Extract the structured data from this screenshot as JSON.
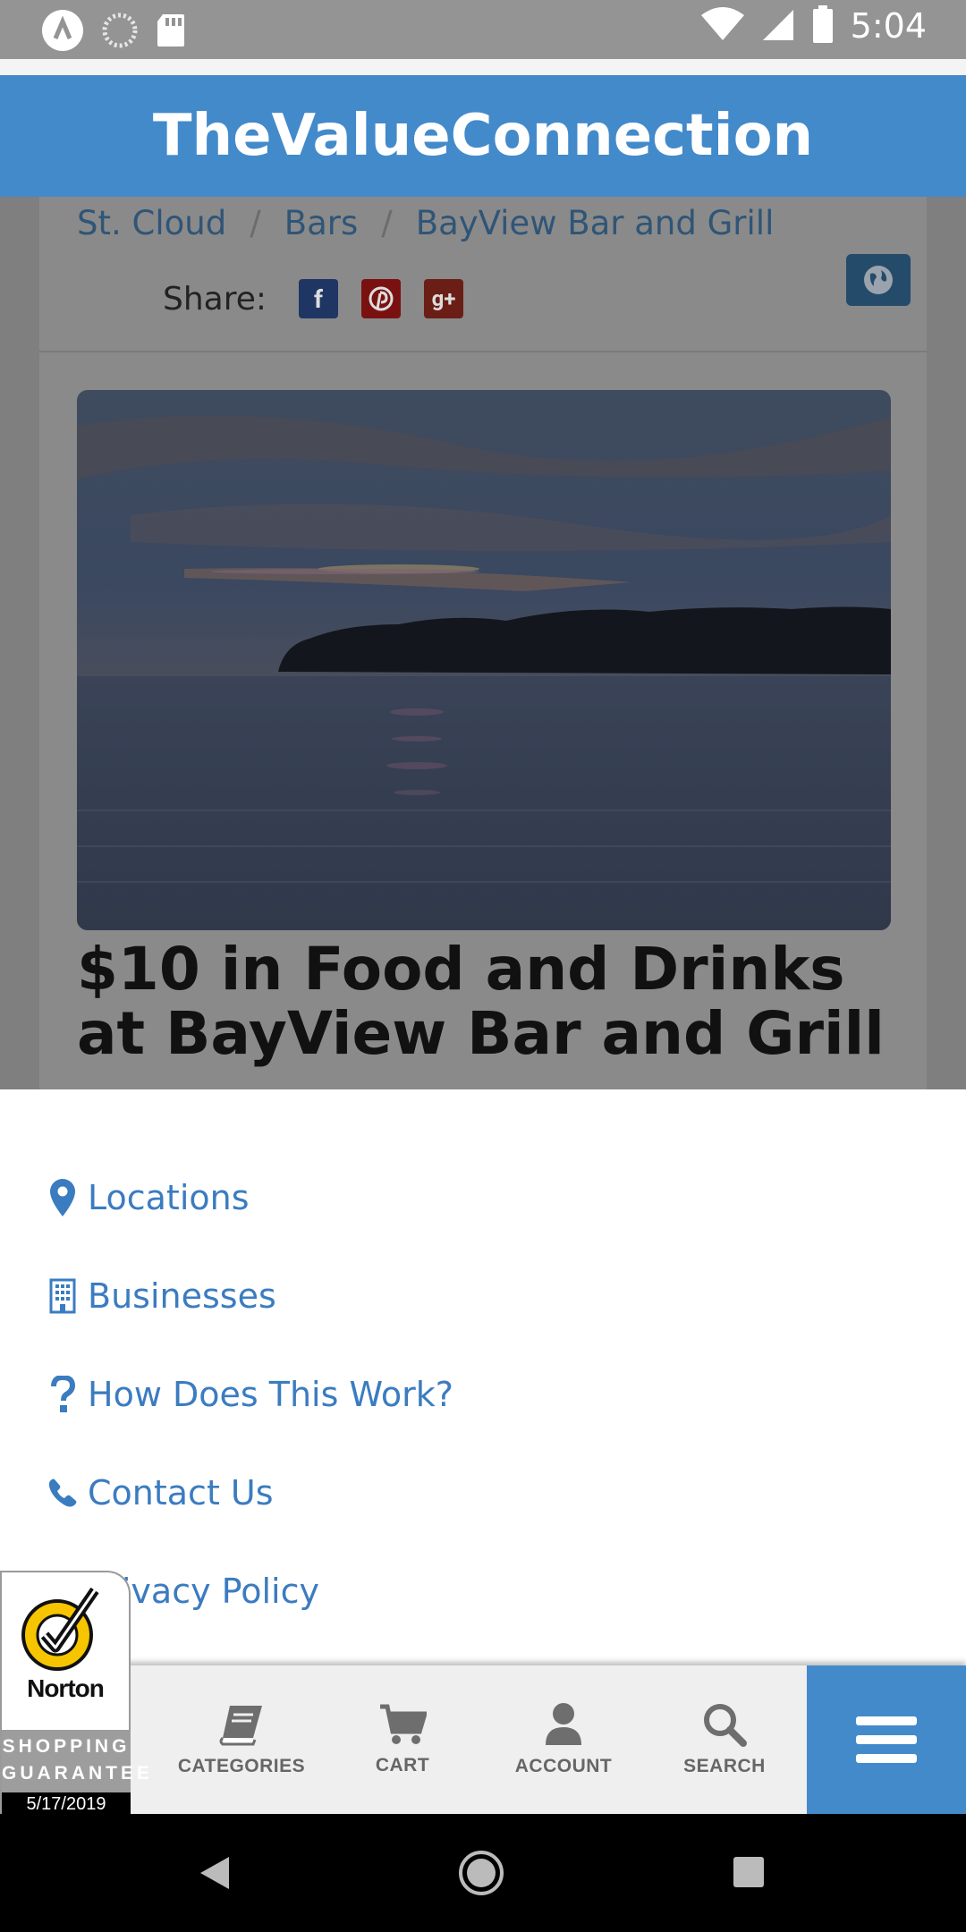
{
  "status_bar": {
    "time": "5:04"
  },
  "header": {
    "title": "TheValueConnection"
  },
  "breadcrumb": [
    "St. Cloud",
    "Bars",
    "BayView Bar and Grill"
  ],
  "share": {
    "label": "Share:"
  },
  "deal": {
    "title": "$10 in Food and Drinks at BayView Bar and Grill"
  },
  "menu": {
    "items": [
      {
        "label": "Locations",
        "icon": "map-marker-icon"
      },
      {
        "label": "Businesses",
        "icon": "building-icon"
      },
      {
        "label": "How Does This Work?",
        "icon": "question-icon"
      },
      {
        "label": "Contact Us",
        "icon": "phone-icon"
      },
      {
        "label": "Privacy Policy",
        "icon": "lock-icon"
      }
    ]
  },
  "bottom_nav": {
    "categories": "CATEGORIES",
    "cart": "CART",
    "account": "ACCOUNT",
    "search": "SEARCH"
  },
  "norton": {
    "brand": "Norton",
    "guarantee_line1": "SHOPPING",
    "guarantee_line2": "GUARANTEE",
    "date": "5/17/2019"
  },
  "colors": {
    "brand_blue": "#438acb",
    "link_blue": "#3b7cc0"
  }
}
